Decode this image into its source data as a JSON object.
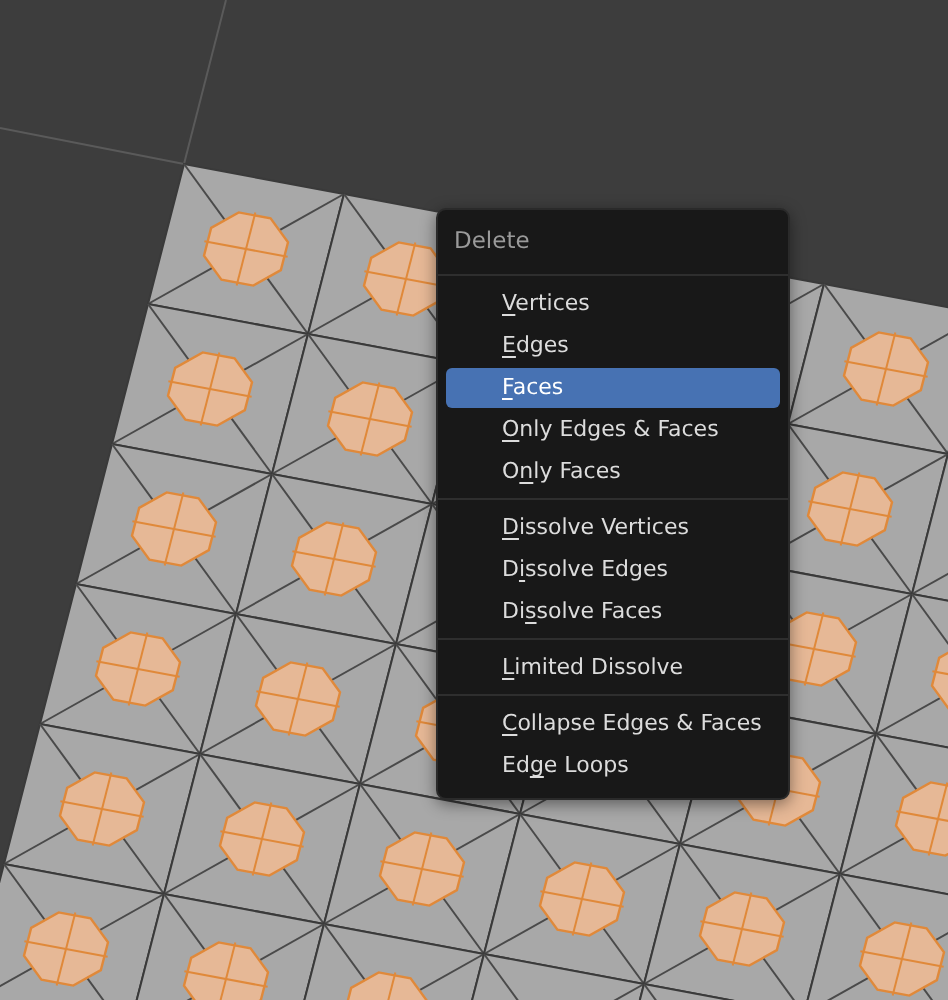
{
  "menu": {
    "title": "Delete",
    "groups": [
      [
        {
          "key": "V",
          "post": "ertices",
          "selected": false
        },
        {
          "key": "E",
          "post": "dges",
          "selected": false
        },
        {
          "key": "F",
          "post": "aces",
          "selected": true
        },
        {
          "key": "O",
          "post": "nly Edges & Faces",
          "selected": false
        },
        {
          "pre": "O",
          "key": "n",
          "post": "ly Faces",
          "selected": false
        }
      ],
      [
        {
          "key": "D",
          "post": "issolve Vertices",
          "selected": false
        },
        {
          "pre": "D",
          "key": "i",
          "post": "ssolve Edges",
          "selected": false
        },
        {
          "pre": "Di",
          "key": "s",
          "post": "solve Faces",
          "selected": false
        }
      ],
      [
        {
          "key": "L",
          "post": "imited Dissolve",
          "selected": false
        }
      ],
      [
        {
          "key": "C",
          "post": "ollapse Edges & Faces",
          "selected": false
        },
        {
          "pre": "Ed",
          "key": "g",
          "post": "e Loops",
          "selected": false
        }
      ]
    ]
  }
}
